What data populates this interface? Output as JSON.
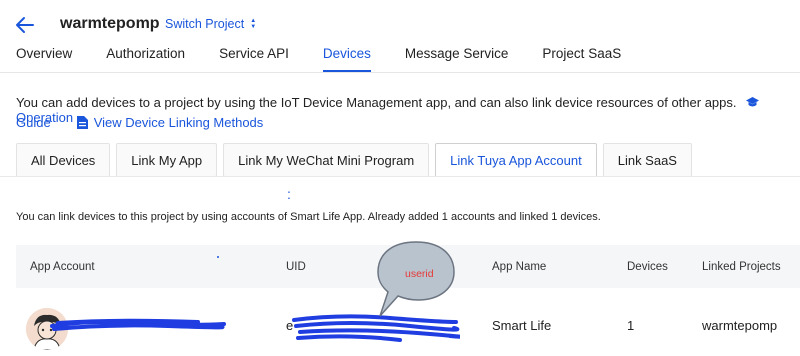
{
  "header": {
    "project_name": "warmtepomp",
    "switch_label": "Switch Project"
  },
  "main_tabs": [
    {
      "label": "Overview",
      "active": false
    },
    {
      "label": "Authorization",
      "active": false
    },
    {
      "label": "Service API",
      "active": false
    },
    {
      "label": "Devices",
      "active": true
    },
    {
      "label": "Message Service",
      "active": false
    },
    {
      "label": "Project SaaS",
      "active": false
    }
  ],
  "info": {
    "text": "You can add devices to a project by using the IoT Device Management app, and can also link device resources of other apps.",
    "guide_link_line1": "Operation",
    "guide_link_line2": "Guide",
    "view_methods": "View Device Linking Methods"
  },
  "sub_tabs": [
    {
      "label": "All Devices",
      "active": false
    },
    {
      "label": "Link My App",
      "active": false
    },
    {
      "label": "Link My WeChat Mini Program",
      "active": false
    },
    {
      "label": "Link Tuya App Account",
      "active": true
    },
    {
      "label": "Link SaaS",
      "active": false
    }
  ],
  "summary": "You can link devices to this project by using accounts of Smart Life App. Already added 1 accounts and linked 1 devices.",
  "annotation": {
    "bubble_text": "userid",
    "colon_mark": ":"
  },
  "table": {
    "headers": [
      "App Account",
      "UID",
      "App Name",
      "Devices",
      "Linked Projects"
    ],
    "rows": [
      {
        "app_account": "",
        "uid_prefix": "e",
        "app_name": "Smart Life",
        "devices": "1",
        "linked_projects": "warmtepomp"
      }
    ]
  },
  "colors": {
    "accent": "#1a56db",
    "redaction": "#1f3de0",
    "bubble_text": "#e53935"
  }
}
